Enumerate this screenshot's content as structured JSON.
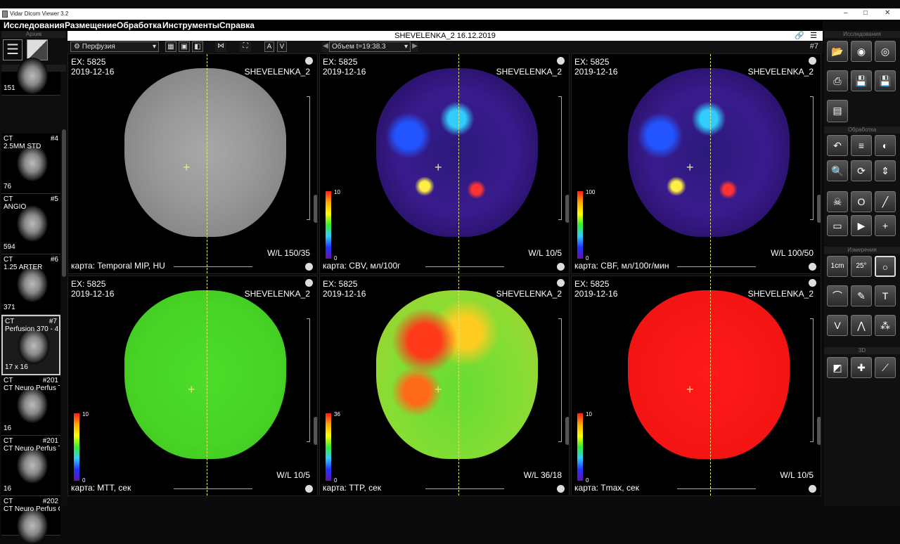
{
  "window": {
    "title": "Vidar Dicom Viewer 3.2",
    "controls": [
      "–",
      "□",
      "✕"
    ]
  },
  "menu": [
    "Исследования",
    "Размещение",
    "Обработка",
    "Инструменты",
    "Справка"
  ],
  "study_bar": {
    "title": "SHEVELENKA_2  16.12.2019",
    "number": "#7"
  },
  "left_panel": {
    "archive_label": "Архив",
    "tape_label": "Лента",
    "series": [
      {
        "mod": "",
        "num": "",
        "desc": "",
        "count": "151"
      },
      {
        "mod": "CT",
        "num": "#4",
        "desc": "2.5MM STD",
        "count": "76"
      },
      {
        "mod": "CT",
        "num": "#5",
        "desc": "ANGIO",
        "count": "594"
      },
      {
        "mod": "CT",
        "num": "#6",
        "desc": "1.25 ARTER",
        "count": "371"
      },
      {
        "mod": "CT",
        "num": "#7",
        "desc": "Perfusion 370 - 4",
        "count": "17 x 16"
      },
      {
        "mod": "CT",
        "num": "#201",
        "desc": "CT Neuro Perfus Temporal MIP",
        "count": "16"
      },
      {
        "mod": "CT",
        "num": "#201",
        "desc": "CT Neuro Perfus Temporal MIP",
        "count": "16"
      },
      {
        "mod": "CT",
        "num": "#202",
        "desc": "CT Neuro Perfus Cerebral Blood F",
        "count": ""
      }
    ]
  },
  "toolbar": {
    "mode": "Перфузия",
    "volume": "Объем  t=19:38.3",
    "btn_a": "A",
    "btn_v": "V"
  },
  "viewports": [
    {
      "ex": "EX: 5825",
      "date": "2019-12-16",
      "patient": "SHEVELENKA_2",
      "wl": "W/L 150/35",
      "map": "карта: Temporal MIP, HU",
      "scale_max": "",
      "scale_min": "",
      "kind": "gray"
    },
    {
      "ex": "EX: 5825",
      "date": "2019-12-16",
      "patient": "SHEVELENKA_2",
      "wl": "W/L 10/5",
      "map": "карта: CBV, мл/100г",
      "scale_max": "10",
      "scale_min": "0",
      "kind": "cbv"
    },
    {
      "ex": "EX: 5825",
      "date": "2019-12-16",
      "patient": "SHEVELENKA_2",
      "wl": "W/L 100/50",
      "map": "карта: CBF, мл/100г/мин",
      "scale_max": "100",
      "scale_min": "0",
      "kind": "cbf"
    },
    {
      "ex": "EX: 5825",
      "date": "2019-12-16",
      "patient": "SHEVELENKA_2",
      "wl": "W/L 10/5",
      "map": "карта: MTT, сек",
      "scale_max": "10",
      "scale_min": "0",
      "kind": "mtt"
    },
    {
      "ex": "EX: 5825",
      "date": "2019-12-16",
      "patient": "SHEVELENKA_2",
      "wl": "W/L 36/18",
      "map": "карта: TTP, сек",
      "scale_max": "36",
      "scale_min": "0",
      "kind": "ttp"
    },
    {
      "ex": "EX: 5825",
      "date": "2019-12-16",
      "patient": "SHEVELENKA_2",
      "wl": "W/L 10/5",
      "map": "карта: Tmax, сек",
      "scale_max": "10",
      "scale_min": "0",
      "kind": "tmax"
    }
  ],
  "right_panel": {
    "sect_studies": "Исследования",
    "sect_processing": "Обработка",
    "sect_measure": "Измерения",
    "sect_3d": "3D",
    "measure_1cm": "1cm",
    "measure_angle": "25°",
    "measure_v": "V"
  },
  "colors": {
    "accent_dash": "#e8e86a",
    "background": "#000000"
  }
}
